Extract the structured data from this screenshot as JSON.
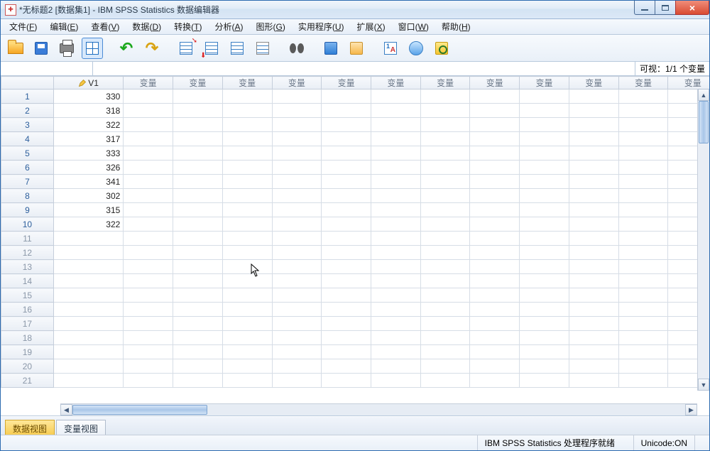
{
  "window": {
    "title": "*无标题2 [数据集1] - IBM SPSS Statistics 数据编辑器"
  },
  "menu": {
    "file": {
      "label": "文件",
      "key": "F"
    },
    "edit": {
      "label": "编辑",
      "key": "E"
    },
    "view": {
      "label": "查看",
      "key": "V"
    },
    "data": {
      "label": "数据",
      "key": "D"
    },
    "trans": {
      "label": "转换",
      "key": "T"
    },
    "analyze": {
      "label": "分析",
      "key": "A"
    },
    "graph": {
      "label": "图形",
      "key": "G"
    },
    "util": {
      "label": "实用程序",
      "key": "U"
    },
    "ext": {
      "label": "扩展",
      "key": "X"
    },
    "window": {
      "label": "窗口",
      "key": "W"
    },
    "help": {
      "label": "帮助",
      "key": "H"
    }
  },
  "visibility": {
    "label": "可视：1/1 个变量"
  },
  "columns": {
    "v1": "V1",
    "var": "变量",
    "var_short": "变量"
  },
  "data_rows": [
    "330",
    "318",
    "322",
    "317",
    "333",
    "326",
    "341",
    "302",
    "315",
    "322"
  ],
  "empty_rows": [
    "11",
    "12",
    "13",
    "14",
    "15",
    "16",
    "17",
    "18",
    "19",
    "20",
    "21"
  ],
  "tabs": {
    "data_view": "数据视图",
    "var_view": "变量视图"
  },
  "status": {
    "ready": "IBM SPSS Statistics 处理程序就绪",
    "unicode": "Unicode:ON"
  },
  "toolbar_names": {
    "open": "open",
    "save": "save",
    "print": "print",
    "recall": "recall-dialog",
    "undo": "undo",
    "redo": "redo",
    "goto_case": "goto-case",
    "goto_var": "goto-variable",
    "variables": "variables",
    "find": "find",
    "split": "split-file",
    "weight": "weight-cases",
    "select": "select-cases",
    "value_labels": "value-labels",
    "use_sets": "use-variable-sets",
    "show_all": "show-all-variables"
  }
}
